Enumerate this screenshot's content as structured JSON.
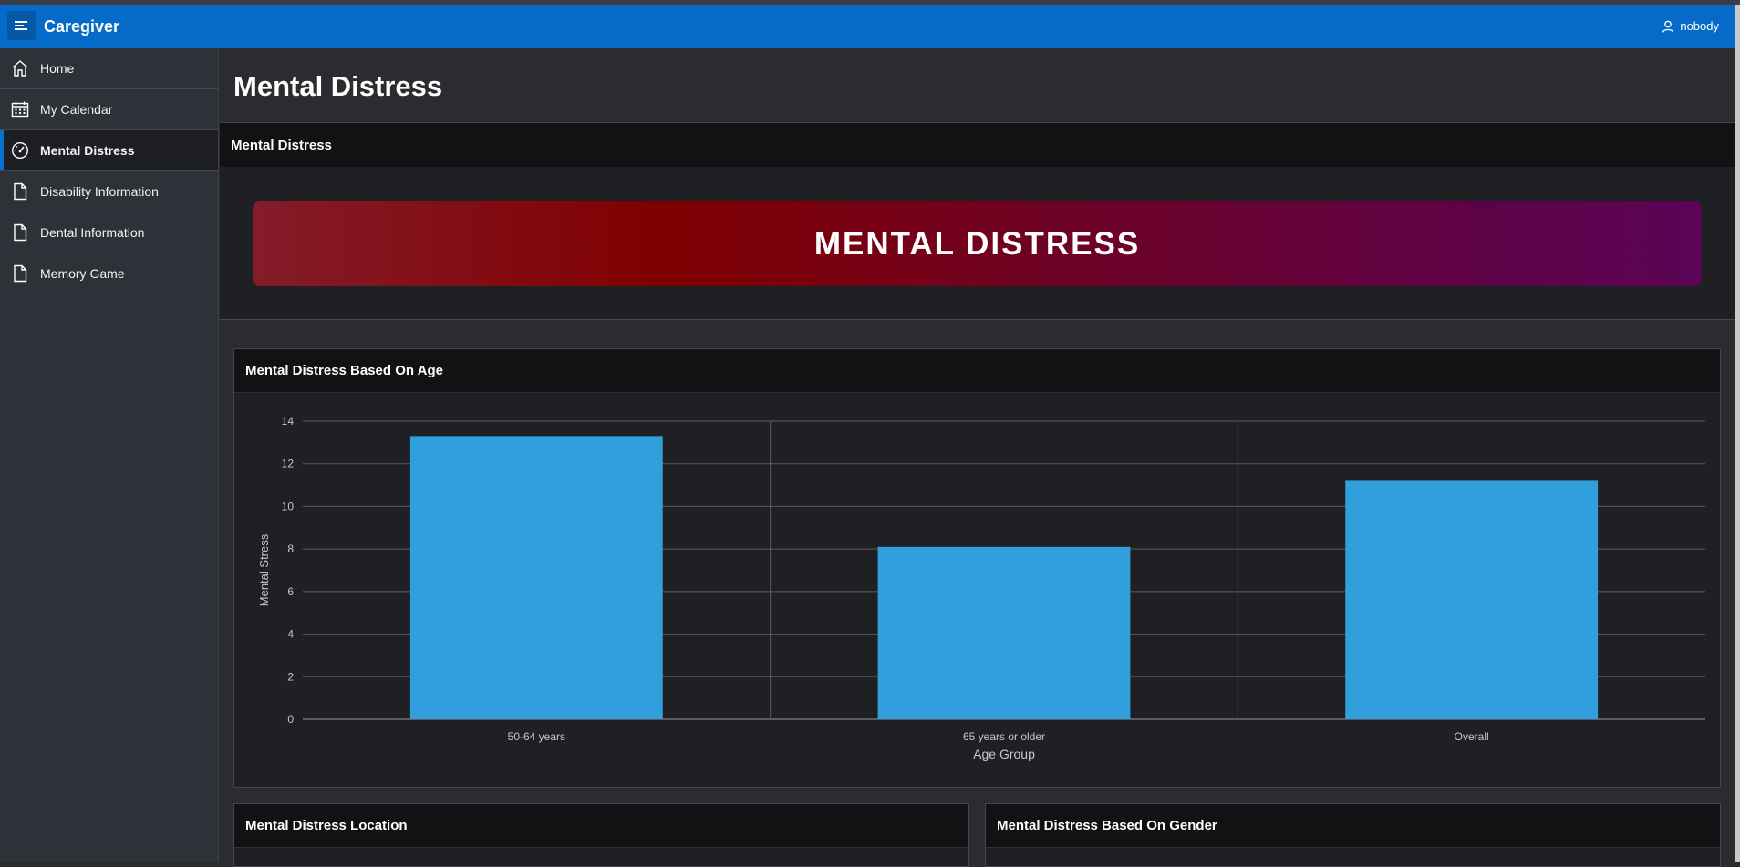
{
  "header": {
    "app_title": "Caregiver",
    "user_name": "nobody",
    "menu_icon": "hamburger-icon",
    "user_icon": "user-icon"
  },
  "sidebar": {
    "items": [
      {
        "label": "Home",
        "icon": "home-icon",
        "active": false
      },
      {
        "label": "My Calendar",
        "icon": "calendar-icon",
        "active": false
      },
      {
        "label": "Mental Distress",
        "icon": "gauge-icon",
        "active": true
      },
      {
        "label": "Disability Information",
        "icon": "file-icon",
        "active": false
      },
      {
        "label": "Dental Information",
        "icon": "file-icon",
        "active": false
      },
      {
        "label": "Memory Game",
        "icon": "file-icon",
        "active": false
      }
    ]
  },
  "main": {
    "page_title": "Mental Distress",
    "hero_region_title": "Mental Distress",
    "banner_text": "MENTAL DISTRESS",
    "chart_card_title": "Mental Distress Based On Age",
    "location_card_title": "Mental Distress Location",
    "gender_card_title": "Mental Distress Based On Gender"
  },
  "colors": {
    "header": "#056ac8",
    "bar": "#309fdc",
    "active_accent": "#0572ce"
  },
  "chart_data": {
    "type": "bar",
    "categories": [
      "50-64 years",
      "65 years or older",
      "Overall"
    ],
    "values": [
      13.3,
      8.1,
      11.2
    ],
    "xlabel": "Age Group",
    "ylabel": "Mental Stress",
    "ylim": [
      0,
      14
    ],
    "yticks": [
      "0",
      "2",
      "4",
      "6",
      "8",
      "10",
      "12",
      "14"
    ],
    "grid": true
  }
}
